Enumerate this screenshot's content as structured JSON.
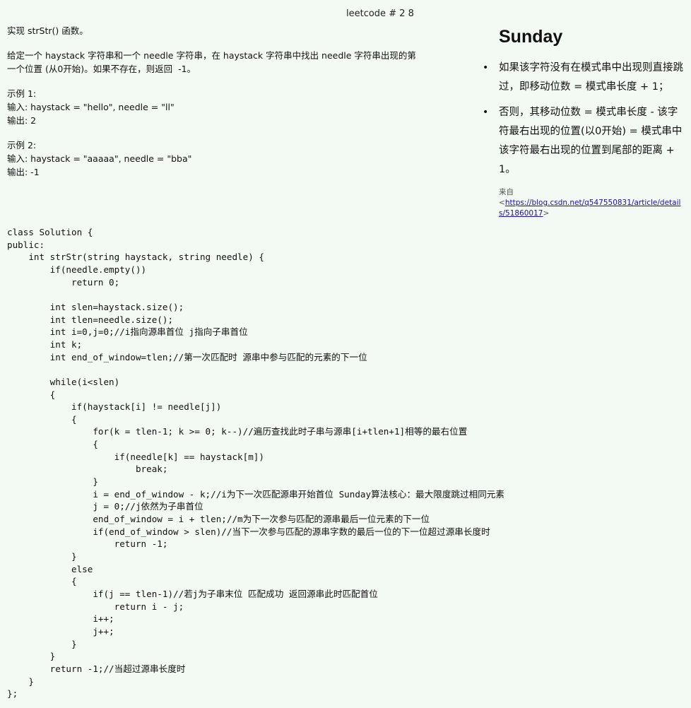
{
  "title": "leetcode # 2 8",
  "problem": {
    "lines": [
      "实现 strStr() 函数。",
      "",
      "给定一个 haystack 字符串和一个 needle 字符串，在 haystack 字符串中找出 needle 字符串出现的第",
      "一个位置 (从0开始)。如果不存在，则返回  -1。",
      "",
      "示例 1:",
      "输入: haystack = \"hello\", needle = \"ll\"",
      "输出: 2",
      "",
      "示例 2:",
      "输入: haystack = \"aaaaa\", needle = \"bba\"",
      "输出: -1"
    ]
  },
  "code": {
    "lines": [
      "class Solution {",
      "public:",
      "    int strStr(string haystack, string needle) {",
      "        if(needle.empty())",
      "            return 0;",
      "",
      "        int slen=haystack.size();",
      "        int tlen=needle.size();",
      "        int i=0,j=0;//i指向源串首位 j指向子串首位",
      "        int k;",
      "        int end_of_window=tlen;//第一次匹配时 源串中参与匹配的元素的下一位",
      "",
      "        while(i<slen)",
      "        {",
      "            if(haystack[i] != needle[j])",
      "            {",
      "                for(k = tlen-1; k >= 0; k--)//遍历查找此时子串与源串[i+tlen+1]相等的最右位置",
      "                {",
      "                    if(needle[k] == haystack[m])",
      "                        break;",
      "                }",
      "                i = end_of_window - k;//i为下一次匹配源串开始首位 Sunday算法核心：最大限度跳过相同元素",
      "                j = 0;//j依然为子串首位",
      "                end_of_window = i + tlen;//m为下一次参与匹配的源串最后一位元素的下一位",
      "                if(end_of_window > slen)//当下一次参与匹配的源串字数的最后一位的下一位超过源串长度时",
      "                    return -1;",
      "            }",
      "            else",
      "            {",
      "                if(j == tlen-1)//若j为子串末位 匹配成功 返回源串此时匹配首位",
      "                    return i - j;",
      "                i++;",
      "                j++;",
      "            }",
      "        }",
      "        return -1;//当超过源串长度时",
      "    }",
      "};"
    ]
  },
  "sidebar": {
    "heading": "Sunday",
    "bullet_glyph": "•",
    "bullets": [
      "如果该字符没有在模式串中出现则直接跳过，即移动位数 = 模式串长度 + 1；",
      "否则，其移动位数 = 模式串长度 - 该字符最右出现的位置(以0开始) = 模式串中该字符最右出现的位置到尾部的距离 + 1。"
    ],
    "source_label": "来自",
    "source_open": "<",
    "source_url": "https://blog.csdn.net/q547550831/article/details/51860017",
    "source_close": ">"
  }
}
